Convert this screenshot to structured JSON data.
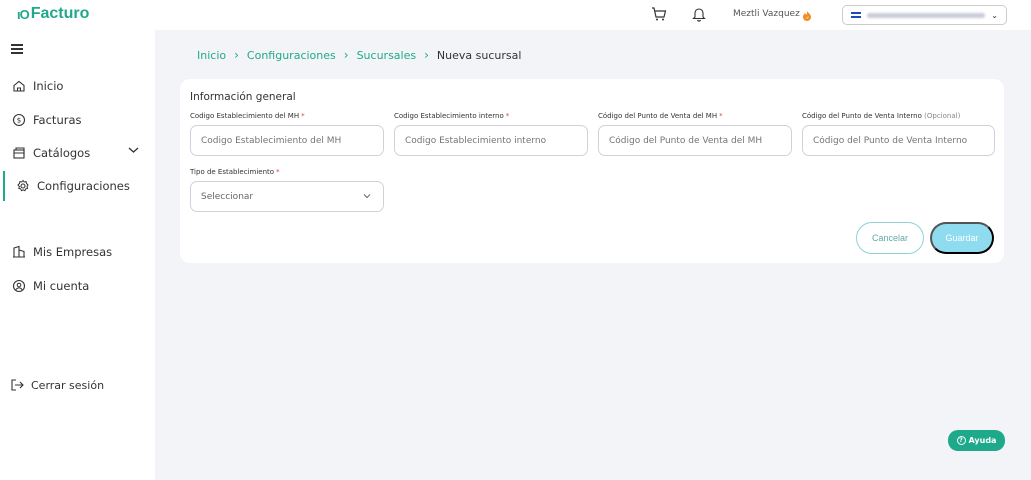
{
  "brand": {
    "name": "Facturo",
    "mark": "ιO",
    "color": "#1fa98b"
  },
  "header": {
    "user_name": "Meztli Vazquez",
    "company_chevron": "⌄"
  },
  "sidebar": {
    "items": [
      {
        "label": "Inicio",
        "icon": "home-icon"
      },
      {
        "label": "Facturas",
        "icon": "dollar-circle-icon"
      },
      {
        "label": "Catálogos",
        "icon": "catalog-icon"
      },
      {
        "label": "Configuraciones",
        "icon": "gear-icon"
      },
      {
        "label": "Mis Empresas",
        "icon": "building-icon"
      },
      {
        "label": "Mi cuenta",
        "icon": "user-circle-icon"
      }
    ],
    "logout_label": "Cerrar sesión"
  },
  "breadcrumb": [
    "Inicio",
    "Configuraciones",
    "Sucursales",
    "Nueva sucursal"
  ],
  "form": {
    "section_title": "Información general",
    "fields": [
      {
        "label": "Codigo Establecimiento del MH",
        "required": "*",
        "placeholder": "Codigo Establecimiento del MH"
      },
      {
        "label": "Codigo Establecimiento interno",
        "required": "*",
        "placeholder": "Codigo Establecimiento interno"
      },
      {
        "label": "Código del Punto de Venta del MH",
        "required": "*",
        "placeholder": "Código del Punto de Venta del MH"
      },
      {
        "label": "Código del Punto de Venta Interno",
        "optional": "(Opcional)",
        "placeholder": "Código del Punto de Venta Interno"
      }
    ],
    "tipo": {
      "label": "Tipo de Establecimiento",
      "required": "*",
      "value": "Seleccionar"
    }
  },
  "actions": {
    "cancel": "Cancelar",
    "save": "Guardar"
  },
  "help": {
    "label": "Ayuda",
    "icon": "?"
  },
  "colors": {
    "accent": "#1fa98b",
    "save_button": "#8fdbf0",
    "background": "#f3f4f8"
  }
}
